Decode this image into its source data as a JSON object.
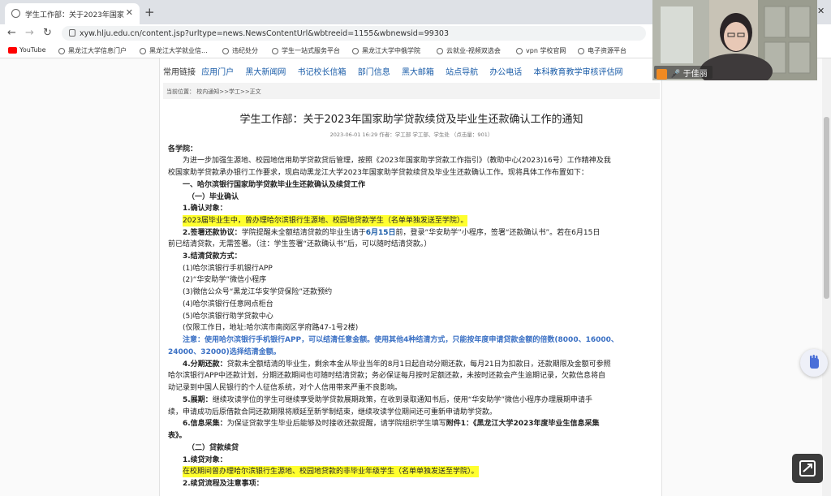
{
  "browser": {
    "tab_title": "学生工作部：关于2023年国家助学贷款续贷及毕业生还款确认工作的通知",
    "url": "xyw.hlju.edu.cn/content.jsp?urltype=news.NewsContentUrl&wbtreeid=1155&wbnewsid=99303",
    "bookmarks": [
      "YouTube",
      "黑龙江大学信息门户",
      "黑龙江大学就业信...",
      "违纪处分",
      "学生一站式服务平台",
      "黑龙江大学中俄学院",
      "云就业-视频双选会",
      "vpn 学校官网",
      "电子资源平台"
    ]
  },
  "site": {
    "links_label": "常用链接",
    "links": [
      "应用门户",
      "黑大新闻网",
      "书记校长信箱",
      "部门信息",
      "黑大邮箱",
      "站点导航",
      "办公电话",
      "本科教育教学审核评估网"
    ],
    "breadcrumb": "当前位置： 校内通知>>学工>>正文"
  },
  "article": {
    "title": "学生工作部：关于2023年国家助学贷款续贷及毕业生还款确认工作的通知",
    "meta": "2023-06-01 16:29  作者：学工部   学工部、学生处         （点击量：901）",
    "salutation": "各学院：",
    "intro1": "为进一步加强生源地、校园地信用助学贷款贷后管理，按照《2023年国家助学贷款工作指引》（教助中心(2023)16号）工作精神及我",
    "intro2": "校国家助学贷款承办银行工作要求，现启动黑龙江大学2023年国家助学贷款续贷及毕业生还款确认工作。现将具体工作布置如下：",
    "sec1": "一、哈尔滨银行国家助学贷款毕业生还款确认及续贷工作",
    "sub1": "（一）毕业确认",
    "item1": "1.确认对象：",
    "item1_text": "2023届毕业生中，曾办理哈尔滨银行生源地、校园地贷款学生（名单单独发送至学院）。",
    "item2_label": "2.签署还款协议：",
    "item2_text_a": "学院提醒未全额结清贷款的毕业生请于",
    "item2_date": "6月15日",
    "item2_text_b": "前，登录“华安助学”小程序，签署“还款确认书”。若在6月15日",
    "item2_line2": "前已结清贷款，无需签署。（注：学生签署“还款确认书”后，可以随时结清贷款。）",
    "item3": "3.结清贷款方式：",
    "methods": [
      "(1)哈尔滨银行手机银行APP",
      "(2)“华安助学”微信小程序",
      "(3)微信公众号“黑龙江华安学贷保险”还款预约",
      "(4)哈尔滨银行任意网点柜台",
      "(5)哈尔滨银行助学贷款中心",
      "(仅限工作日，地址:哈尔滨市南岗区学府路47-1号2楼)"
    ],
    "note1": "注意：使用哈尔滨银行手机银行APP，可以结清任意金额。使用其他4种结清方式，只能按年度申请贷款金额的倍数(8000、16000、",
    "note2": "24000、32000)选择结清金额。",
    "item4_label": "4.分期还款：",
    "item4_line1": "贷款未全额结清的毕业生，剩余本金从毕业当年的8月1日起自动分期还款，每月21日为扣款日，还款期限及金额可参照",
    "item4_line2": "哈尔滨银行APP中还款计划，分期还款期间也可随时结清贷款；务必保证每月按时足额还款，未按时还款会产生逾期记录，欠款信息将自",
    "item4_line3": "动记录到中国人民银行的个人征信系统，对个人信用带来严重不良影响。",
    "item5_label": "5.展期：",
    "item5_line1": "继续攻读学位的学生可继续享受助学贷款展期政策，在收到录取通知书后，使用“华安助学”微信小程序办理展期申请手",
    "item5_line2": "续，申请成功后原借款合同还款期限将顺延至新学制结束，继续攻读学位期间还可重新申请助学贷款。",
    "item6_label": "6.信息采集：",
    "item6_text": "为保证贷款学生毕业后能够及时接收还款提醒，请学院组织学生填写",
    "item6_attach": "附件1：《黑龙江大学2023年度毕业生信息采集",
    "item6_line2": "表》。",
    "sub2": "（二）贷款续贷",
    "item7": "1.续贷对象：",
    "item7_text": "在校期间曾办理哈尔滨银行生源地、校园地贷款的非毕业年级学生（名单单独发送至学院）。",
    "item8": "2.续贷流程及注意事项："
  },
  "webcam": {
    "name": "于佳丽"
  },
  "icons": [
    "globe-icon",
    "close-icon",
    "plus-icon",
    "back-icon",
    "forward-icon",
    "reload-icon",
    "lock-icon",
    "microphone-icon",
    "user-icon",
    "hand-icon",
    "share-screen-icon"
  ],
  "colors": {
    "link": "#1a5ca8",
    "highlight": "#ffff2e",
    "note": "#3a70c4",
    "date": "#1a5ca8"
  }
}
